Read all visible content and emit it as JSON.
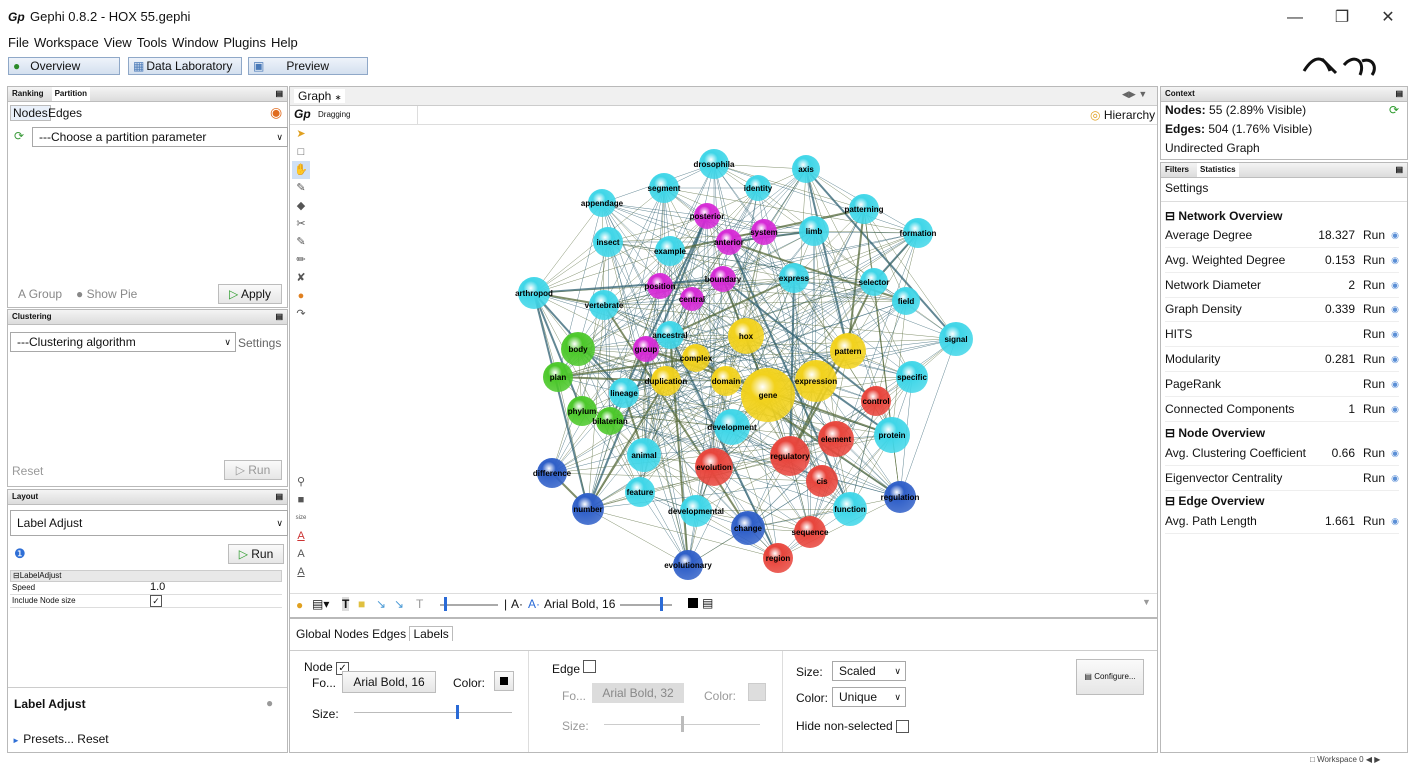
{
  "window": {
    "title": "Gephi 0.8.2 - HOX 55.gephi",
    "app_icon": "Gp"
  },
  "menu": [
    "File",
    "Workspace",
    "View",
    "Tools",
    "Window",
    "Plugins",
    "Help"
  ],
  "modes": {
    "overview": "Overview",
    "data_lab": "Data Laboratory",
    "preview": "Preview"
  },
  "ranking_tabs": {
    "ranking": "Ranking",
    "partition": "Partition"
  },
  "partition": {
    "nodes": "Nodes",
    "edges": "Edges",
    "param": "---Choose a partition parameter",
    "group": "Group",
    "show_pie": "Show Pie",
    "apply": "Apply"
  },
  "clustering": {
    "header": "Clustering",
    "algorithm": "---Clustering algorithm",
    "settings": "Settings",
    "reset": "Reset",
    "run": "Run"
  },
  "layout": {
    "header": "Layout",
    "algorithm": "Label Adjust",
    "run": "Run",
    "prop_group": "LabelAdjust",
    "speed_label": "Speed",
    "speed_value": "1.0",
    "include_label": "Include Node size",
    "name": "Label Adjust",
    "presets": "Presets...",
    "reset": "Reset"
  },
  "graph": {
    "tab": "Graph",
    "mode": "Dragging",
    "hierarchy": "Hierarchy",
    "font": "Arial Bold, 16"
  },
  "labels_tabs": [
    "Global",
    "Nodes",
    "Edges",
    "Labels"
  ],
  "labels": {
    "node": "Node",
    "node_font_lbl": "Fo...",
    "node_font": "Arial Bold, 16",
    "color": "Color:",
    "size": "Size:",
    "edge": "Edge",
    "edge_font_lbl": "Fo...",
    "edge_font": "Arial Bold, 32",
    "size_mode_lbl": "Size:",
    "size_mode": "Scaled",
    "color_mode_lbl": "Color:",
    "color_mode": "Unique",
    "hide": "Hide non-selected",
    "configure": "Configure..."
  },
  "context": {
    "header": "Context",
    "nodes_lbl": "Nodes:",
    "nodes": "55 (2.89% Visible)",
    "edges_lbl": "Edges:",
    "edges": "504 (1.76% Visible)",
    "type": "Undirected Graph"
  },
  "stats_tabs": {
    "filters": "Filters",
    "statistics": "Statistics",
    "settings": "Settings"
  },
  "stats": {
    "network_overview": "Network Overview",
    "node_overview": "Node Overview",
    "edge_overview": "Edge Overview",
    "run": "Run",
    "rows": [
      {
        "label": "Average Degree",
        "value": "18.327"
      },
      {
        "label": "Avg. Weighted Degree",
        "value": "0.153"
      },
      {
        "label": "Network Diameter",
        "value": "2"
      },
      {
        "label": "Graph Density",
        "value": "0.339"
      },
      {
        "label": "HITS",
        "value": ""
      },
      {
        "label": "Modularity",
        "value": "0.281"
      },
      {
        "label": "PageRank",
        "value": ""
      },
      {
        "label": "Connected Components",
        "value": "1"
      },
      {
        "label": "Avg. Clustering Coefficient",
        "value": "0.66"
      },
      {
        "label": "Eigenvector Centrality",
        "value": ""
      },
      {
        "label": "Avg. Path Length",
        "value": "1.661"
      }
    ]
  },
  "status": {
    "workspace": "Workspace 0"
  },
  "colors": {
    "cyan": "#3fd6e8",
    "magenta": "#d62ad6",
    "yellow": "#f2d21c",
    "red": "#e8453c",
    "green": "#4cc82a",
    "blue": "#2f5fc8"
  },
  "nodes": [
    {
      "label": "drosophila",
      "color": "cyan"
    },
    {
      "label": "axis",
      "color": "cyan"
    },
    {
      "label": "segment",
      "color": "cyan"
    },
    {
      "label": "identity",
      "color": "cyan"
    },
    {
      "label": "appendage",
      "color": "cyan"
    },
    {
      "label": "posterior",
      "color": "magenta"
    },
    {
      "label": "system",
      "color": "magenta"
    },
    {
      "label": "limb",
      "color": "cyan"
    },
    {
      "label": "patterning",
      "color": "cyan"
    },
    {
      "label": "formation",
      "color": "cyan"
    },
    {
      "label": "insect",
      "color": "cyan"
    },
    {
      "label": "anterior",
      "color": "magenta"
    },
    {
      "label": "example",
      "color": "cyan"
    },
    {
      "label": "boundary",
      "color": "magenta"
    },
    {
      "label": "express",
      "color": "cyan"
    },
    {
      "label": "selector",
      "color": "cyan"
    },
    {
      "label": "field",
      "color": "cyan"
    },
    {
      "label": "position",
      "color": "magenta"
    },
    {
      "label": "central",
      "color": "magenta"
    },
    {
      "label": "arthropod",
      "color": "cyan"
    },
    {
      "label": "vertebrate",
      "color": "cyan"
    },
    {
      "label": "signal",
      "color": "cyan"
    },
    {
      "label": "hox",
      "color": "yellow"
    },
    {
      "label": "ancestral",
      "color": "cyan"
    },
    {
      "label": "body",
      "color": "green"
    },
    {
      "label": "group",
      "color": "magenta"
    },
    {
      "label": "complex",
      "color": "yellow"
    },
    {
      "label": "pattern",
      "color": "yellow"
    },
    {
      "label": "plan",
      "color": "green"
    },
    {
      "label": "duplication",
      "color": "yellow"
    },
    {
      "label": "domain",
      "color": "yellow"
    },
    {
      "label": "expression",
      "color": "yellow"
    },
    {
      "label": "specific",
      "color": "cyan"
    },
    {
      "label": "lineage",
      "color": "cyan"
    },
    {
      "label": "gene",
      "color": "yellow"
    },
    {
      "label": "control",
      "color": "red"
    },
    {
      "label": "phylum",
      "color": "green"
    },
    {
      "label": "bilaterian",
      "color": "green"
    },
    {
      "label": "development",
      "color": "cyan"
    },
    {
      "label": "element",
      "color": "red"
    },
    {
      "label": "protein",
      "color": "cyan"
    },
    {
      "label": "animal",
      "color": "cyan"
    },
    {
      "label": "regulatory",
      "color": "red"
    },
    {
      "label": "difference",
      "color": "blue"
    },
    {
      "label": "evolution",
      "color": "red"
    },
    {
      "label": "cis",
      "color": "red"
    },
    {
      "label": "feature",
      "color": "cyan"
    },
    {
      "label": "regulation",
      "color": "blue"
    },
    {
      "label": "number",
      "color": "blue"
    },
    {
      "label": "developmental",
      "color": "cyan"
    },
    {
      "label": "function",
      "color": "cyan"
    },
    {
      "label": "change",
      "color": "blue"
    },
    {
      "label": "sequence",
      "color": "red"
    },
    {
      "label": "region",
      "color": "red"
    },
    {
      "label": "evolutionary",
      "color": "blue"
    }
  ]
}
